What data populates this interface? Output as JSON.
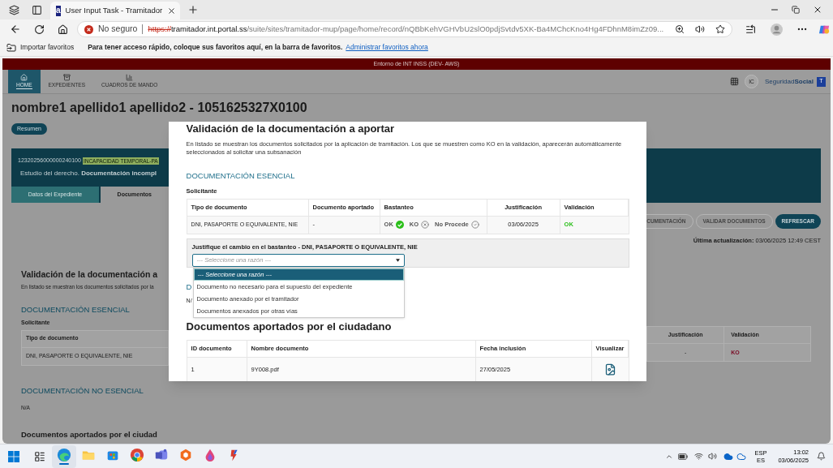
{
  "browser": {
    "tabs": [
      {
        "favicon": "a",
        "title": "User Input Task - Tramitador",
        "selected": true
      }
    ],
    "address": {
      "security": "No seguro",
      "scheme": "https://",
      "host": "tramitador.int.portal.ss",
      "path": "/suite/sites/tramitador-mup/page/home/record/nQBbKehVGHVbU2slO0pdjSvtdv5XK-Ba4MChcKno4Hg4FDhnM8imZz09..."
    },
    "favorites_bar": {
      "import": "Importar favoritos",
      "message": "Para tener acceso rápido, coloque sus favoritos aquí, en la barra de favoritos.",
      "link": "Administrar favoritos ahora"
    }
  },
  "app": {
    "environment": "Entorno de INT INSS (DEV- AWS)",
    "nav": [
      {
        "label": "HOME",
        "kind": "home",
        "selected": true
      },
      {
        "label": "EXPEDIENTES",
        "kind": "archive",
        "selected": false
      },
      {
        "label": "CUADROS DE MANDO",
        "kind": "chart",
        "selected": false
      }
    ],
    "user_initials": "IC",
    "brand": {
      "light": "Seguridad",
      "bold": "Social",
      "badge": "T"
    },
    "title": "nombre1 apellido1 apellido2 - 1051625327X0100",
    "summary_button": "Resumen",
    "case": {
      "number": "12320256000000240100",
      "badge": "INCAPACIDAD TEMPORAL-PA",
      "status": "Estudio del derecho. **Documentación incompl**",
      "tabs": [
        {
          "label": "Datos del Expediente",
          "selected": false
        },
        {
          "label": "Documentos",
          "selected": true
        }
      ]
    },
    "actions": [
      {
        "label": "CUMENTACIÓN",
        "primary": false
      },
      {
        "label": "VALIDAR DOCUMENTOS",
        "primary": false
      },
      {
        "label": "REFRESCAR",
        "primary": true
      }
    ],
    "last_update": "**Última actualización:** 03/06/2025 12:49 CEST",
    "left": {
      "title": "Validación de la documentación a",
      "description": "En listado se muestran los documentos solicitados por la",
      "section": "DOCUMENTACIÓN ESENCIAL",
      "subsection": "Solicitante",
      "table": {
        "column": "Tipo de documento",
        "cell": "DNI, PASAPORTE O EQUIVALENTE, NIE"
      },
      "section_2": "DOCUMENTACIÓN NO ESENCIAL",
      "section_2_value": "N/A",
      "title_2": "Documentos aportados por el ciudad"
    },
    "right": {
      "table": {
        "columns": [
          "Justificación",
          "Validación"
        ],
        "row": {
          "justification": "-",
          "validation": "KO",
          "kind": "ko"
        }
      }
    }
  },
  "modal": {
    "title": "Validación de la documentación a aportar",
    "description": "En listado se muestran los documentos solicitados por la aplicación de tramitación. Los que se muestren como KO en la validación, aparecerán automáticamente seleccionados al solicitar una subsanación",
    "section": "DOCUMENTACIÓN ESENCIAL",
    "subsection": "Solicitante",
    "table": {
      "columns": [
        "Tipo de documento",
        "Documento aportado",
        "Bastanteo",
        "Justificación",
        "Validación"
      ],
      "rows": [
        {
          "type": "DNI, PASAPORTE O EQUIVALENTE, NIE",
          "provided": "-",
          "options": [
            {
              "label": "OK",
              "kind": "check",
              "selected": true
            },
            {
              "label": "KO",
              "kind": "cross",
              "selected": false
            },
            {
              "label": "No Procede",
              "kind": "check",
              "selected": false
            }
          ],
          "justification": "03/06/2025",
          "validation": "OK",
          "kind": "ok"
        }
      ]
    },
    "justification": {
      "label": "Justifique el cambio en el bastanteo - DNI, PASAPORTE O EQUIVALENTE, NIE",
      "placeholder": "--- Seleccione una razón ---",
      "expanded": true,
      "options": [
        {
          "label": "--- Seleccione una razón ---",
          "selected": true
        },
        {
          "label": "Documento no necesario para el supuesto del expediente",
          "selected": false
        },
        {
          "label": "Documento anexado por el tramitador",
          "selected": false
        },
        {
          "label": "Documentos anexados por otras vías",
          "selected": false
        }
      ]
    },
    "section_2": "D",
    "section_2_value": "N/",
    "title_2": "Documentos aportados por el ciudadano",
    "documents": {
      "columns": [
        "ID documento",
        "Nombre documento",
        "Fecha inclusión",
        "Visualizar"
      ],
      "rows": [
        {
          "id": "1",
          "name": "9Y008.pdf",
          "date": "27/05/2025"
        }
      ]
    }
  },
  "taskbar": {
    "apps": [
      {
        "kind": "edge",
        "selected": true
      },
      {
        "kind": "folder",
        "selected": false
      },
      {
        "kind": "store",
        "selected": false
      },
      {
        "kind": "chrome",
        "selected": false
      },
      {
        "kind": "teams",
        "selected": false
      },
      {
        "kind": "hexagon",
        "selected": false
      },
      {
        "kind": "drop",
        "selected": false
      },
      {
        "kind": "tool",
        "selected": false
      }
    ],
    "language": "ESP",
    "layout": "ES",
    "time": "13:02",
    "date": "03/06/2025"
  }
}
